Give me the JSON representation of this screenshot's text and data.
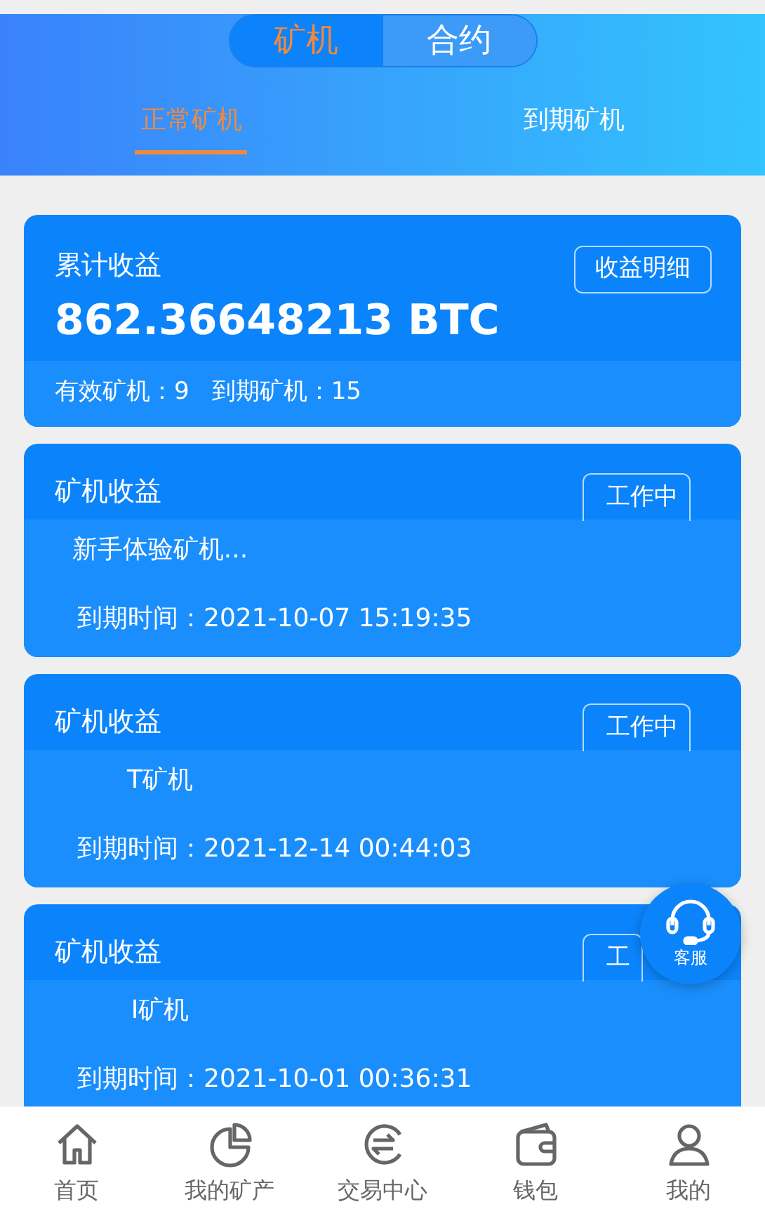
{
  "segment": [
    {
      "label": "矿机",
      "selected": true
    },
    {
      "label": "合约",
      "selected": false
    }
  ],
  "tabs": [
    {
      "label": "正常矿机",
      "selected": true
    },
    {
      "label": "到期矿机",
      "selected": false
    }
  ],
  "summary": {
    "title": "累计收益",
    "amount": "862.36648213 BTC",
    "button": "收益明细",
    "stats": [
      {
        "label": "有效矿机：9"
      },
      {
        "label": "到期矿机：15"
      }
    ]
  },
  "miners": [
    {
      "title": "矿机收益",
      "status": "工作中",
      "name": "新手体验矿机...",
      "expiry": "到期时间：2021-10-07 15:19:35"
    },
    {
      "title": "矿机收益",
      "status": "工作中",
      "name": "T矿机",
      "expiry": "到期时间：2021-12-14 00:44:03"
    },
    {
      "title": "矿机收益",
      "status": "工",
      "name": "I矿机",
      "expiry": "到期时间：2021-10-01 00:36:31"
    }
  ],
  "support_button": "客服",
  "bottom_nav": [
    {
      "kind": "home",
      "label": "首页",
      "selected": false
    },
    {
      "kind": "pie",
      "label": "我的矿产",
      "selected": false
    },
    {
      "kind": "exchange",
      "label": "交易中心",
      "selected": false
    },
    {
      "kind": "wallet",
      "label": "钱包",
      "selected": false
    },
    {
      "kind": "user",
      "label": "我的",
      "selected": false
    }
  ]
}
